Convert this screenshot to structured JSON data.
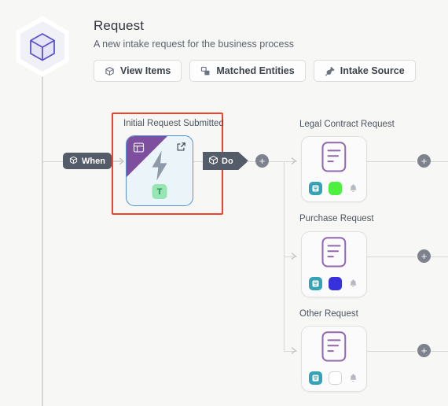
{
  "header": {
    "logo_icon": "cube-hexagon-icon",
    "title": "Request",
    "subtitle": "A new intake request for the business process",
    "buttons": [
      {
        "label": "View Items",
        "icon": "cube-icon"
      },
      {
        "label": "Matched Entities",
        "icon": "copy-stack-icon"
      },
      {
        "label": "Intake Source",
        "icon": "plug-icon"
      }
    ]
  },
  "flow": {
    "when_pill": {
      "label": "When",
      "icon": "cube-icon"
    },
    "do_pill": {
      "label": "Do",
      "icon": "cube-icon"
    },
    "trigger_node": {
      "label": "Initial Request Submitted",
      "corner_icon": "layout-panel-icon",
      "open_icon": "external-link-icon",
      "center_icon": "lightning-bolt-icon",
      "type_badge": "T",
      "selected": true,
      "selection_color": "#f0432f"
    },
    "add_buttons": [
      {
        "name": "add-step-after-trigger",
        "symbol": "+"
      },
      {
        "name": "add-step-legal-contract-request",
        "symbol": "+"
      },
      {
        "name": "add-step-purchase-request",
        "symbol": "+"
      },
      {
        "name": "add-step-other-request",
        "symbol": "+"
      }
    ],
    "branches": [
      {
        "label": "Legal Contract Request",
        "doc_icon": "document-lines-icon",
        "badges": [
          {
            "name": "filter-badge",
            "color": "#35a3b7",
            "icon": "filter-doc-icon"
          },
          {
            "name": "status-color-badge",
            "color": "#4ef03f"
          },
          {
            "name": "notification-bell-badge",
            "color": "#b5b9c0",
            "icon": "bell-icon"
          }
        ]
      },
      {
        "label": "Purchase Request",
        "doc_icon": "document-lines-icon",
        "badges": [
          {
            "name": "filter-badge",
            "color": "#35a3b7",
            "icon": "filter-doc-icon"
          },
          {
            "name": "status-color-badge",
            "color": "#3730dd"
          },
          {
            "name": "notification-bell-badge",
            "color": "#b5b9c0",
            "icon": "bell-icon"
          }
        ]
      },
      {
        "label": "Other Request",
        "doc_icon": "document-lines-icon",
        "badges": [
          {
            "name": "filter-badge",
            "color": "#35a3b7",
            "icon": "filter-doc-icon"
          },
          {
            "name": "status-color-badge",
            "color": "#ffffff"
          },
          {
            "name": "notification-bell-badge",
            "color": "#b5b9c0",
            "icon": "bell-icon"
          }
        ]
      }
    ]
  },
  "colors": {
    "canvas": "#f7f7f6",
    "line": "#d6d6d4",
    "pill": "#555c69",
    "accent_purple": "#6c63d8",
    "doc_purple": "#9268ad"
  }
}
